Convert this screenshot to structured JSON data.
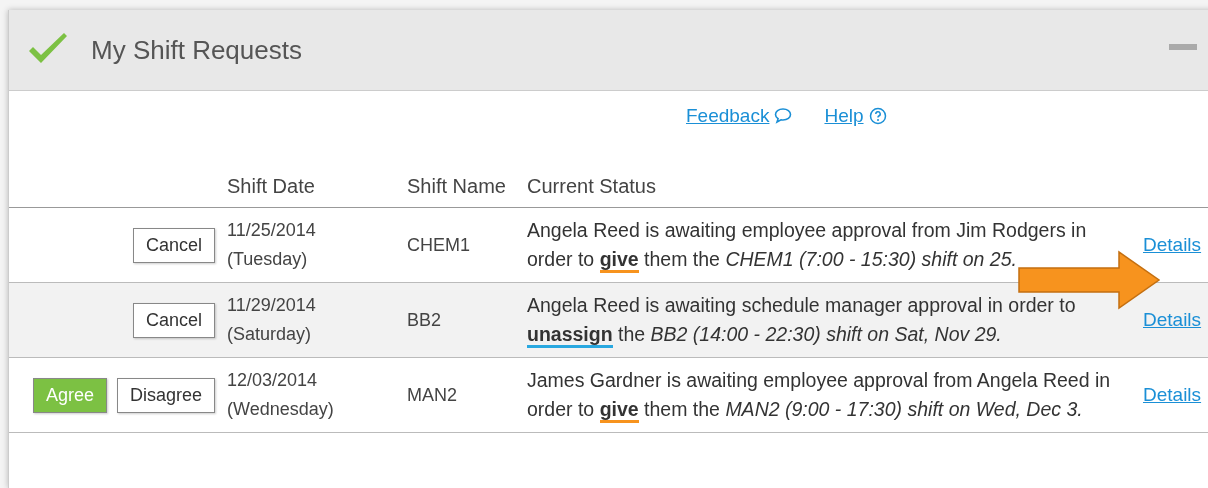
{
  "panel": {
    "title": "My Shift Requests",
    "links": [
      {
        "label": "Feedback",
        "kind": "speech"
      },
      {
        "label": "Help",
        "kind": "help"
      }
    ]
  },
  "table": {
    "columns": [
      "",
      "Shift Date",
      "Shift Name",
      "Current Status",
      ""
    ],
    "rows": [
      {
        "buttons": [
          "Cancel"
        ],
        "date": "11/25/2014",
        "weekday": "(Tuesday)",
        "shift": "CHEM1",
        "status": "Angela Reed is awaiting employee approval from Jim Rodgers in order to **give** them the *CHEM1 (7:00 - 15:30) shift on* *25.*",
        "color": "#f7931e",
        "details": "Details",
        "shaded": false,
        "arrow": true
      },
      {
        "buttons": [
          "Cancel"
        ],
        "date": "11/29/2014",
        "weekday": "(Saturday)",
        "shift": "BB2",
        "status": "Angela Reed is awaiting schedule manager approval in order to **unassign** the *BB2 (14:00 - 22:30) shift on Sat, Nov 29.*",
        "color": "#29a8e0",
        "details": "Details",
        "shaded": true,
        "arrow": false
      },
      {
        "buttons": [
          "Agree",
          "Disagree"
        ],
        "date": "12/03/2014",
        "weekday": "(Wednesday)",
        "shift": "MAN2",
        "status": "James Gardner is awaiting employee approval from Angela Reed in order to **give** them the *MAN2 (9:00 - 17:30) shift on Wed, Dec 3.*",
        "color": "#f7931e",
        "details": "Details",
        "shaded": false,
        "arrow": false
      }
    ]
  }
}
